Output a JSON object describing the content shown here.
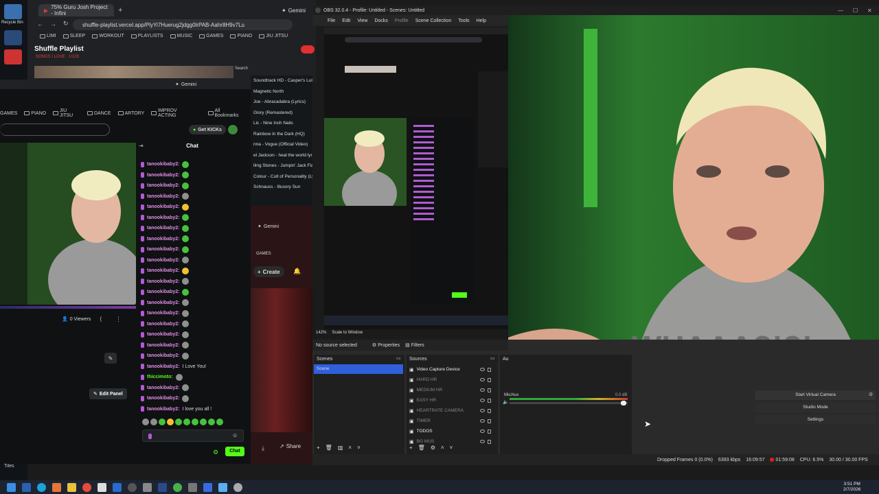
{
  "desktop": {
    "recycle_bin": "Recycle Bin",
    "tiles": "Tiles"
  },
  "browser1": {
    "tab_title": "75% Guru Josh Project - Infini",
    "gemini": "Gemini",
    "url": "shuffle-playlist.vercel.app/PlyYi7Huerug2jdgg0lrPAB-Aahr8H9v7Lu",
    "bookmarks": [
      "LIMI",
      "SLEEP",
      "WORKOUT",
      "PLAYLISTS",
      "MUSIC",
      "GAMES",
      "PIANO",
      "JIU JITSU"
    ],
    "site_title": "Shuffle Playlist",
    "site_subtitle": "SONGS I LOVE · 1/225",
    "search_label": "Search"
  },
  "kick": {
    "gemini": "Gemini",
    "bookmarks": [
      "GAMES",
      "PIANO",
      "JIU JITSU",
      "DANCE",
      "ARTORY",
      "IMPROV ACTING"
    ],
    "all_bookmarks": "All Bookmarks",
    "get_kicks": "Get KICKs",
    "chat_title": "Chat",
    "viewers": "0 Viewers",
    "edit_panel": "Edit Panel",
    "chat_button": "Chat",
    "messages": [
      {
        "user": "tanookibaby2:",
        "text": "",
        "emote": "green"
      },
      {
        "user": "tanookibaby2:",
        "text": "",
        "emote": "green"
      },
      {
        "user": "tanookibaby2:",
        "text": "",
        "emote": "green"
      },
      {
        "user": "tanookibaby2:",
        "text": "",
        "emote": "gray"
      },
      {
        "user": "tanookibaby2:",
        "text": "",
        "emote": "yellow"
      },
      {
        "user": "tanookibaby2:",
        "text": "",
        "emote": "green"
      },
      {
        "user": "tanookibaby2:",
        "text": "",
        "emote": "green"
      },
      {
        "user": "tanookibaby2:",
        "text": "",
        "emote": "green"
      },
      {
        "user": "tanookibaby2:",
        "text": "",
        "emote": "green"
      },
      {
        "user": "tanookibaby2:",
        "text": "",
        "emote": "gray"
      },
      {
        "user": "tanookibaby2:",
        "text": "",
        "emote": "yellow"
      },
      {
        "user": "tanookibaby2:",
        "text": "",
        "emote": "gray"
      },
      {
        "user": "tanookibaby2:",
        "text": "",
        "emote": "green"
      },
      {
        "user": "tanookibaby2:",
        "text": "",
        "emote": "gray"
      },
      {
        "user": "tanookibaby2:",
        "text": "",
        "emote": "gray"
      },
      {
        "user": "tanookibaby2:",
        "text": "",
        "emote": "gray"
      },
      {
        "user": "tanookibaby2:",
        "text": "",
        "emote": "gray"
      },
      {
        "user": "tanookibaby2:",
        "text": "",
        "emote": "gray"
      },
      {
        "user": "tanookibaby2:",
        "text": "",
        "emote": "gray"
      },
      {
        "user": "tanookibaby2:",
        "text": "I Love You!",
        "emote": ""
      },
      {
        "user": "thiccimoto:",
        "text": "",
        "emote": "gray"
      },
      {
        "user": "tanookibaby2:",
        "text": "",
        "emote": "gray"
      },
      {
        "user": "tanookibaby2:",
        "text": "",
        "emote": "gray"
      },
      {
        "user": "tanookibaby2:",
        "text": "I love you all !",
        "emote": ""
      }
    ]
  },
  "playlist": {
    "items": [
      "Soundtrack HD - Casper's Lullaby",
      "Magnetic North",
      "Joe - Abracadabra (Lyrics)",
      "Glory (Remastered)",
      "Lic - Nine Inch Nails",
      "Rainbow In the Dark (HQ)",
      "nna - Vogue (Official Video)",
      "el Jackson - heal the world lyrics",
      "lling Stones - Jumpin' Jack Flash",
      "Colour - Cult of Personality (Lyrics)",
      "Schnauss - Illusory Sun"
    ],
    "gemini": "Gemini",
    "games": "GAMES",
    "create": "Create",
    "share": "Share"
  },
  "obs": {
    "title": "OBS 32.0.4 - Profile: Untitled - Scenes: Untitled",
    "menu": [
      "File",
      "Edit",
      "View",
      "Docks",
      "Profile",
      "Scene Collection",
      "Tools",
      "Help"
    ],
    "no_source": "No source selected",
    "properties": "Properties",
    "filters": "Filters",
    "scenes_title": "Scenes",
    "scenes": [
      "Scene"
    ],
    "sources_title": "Sources",
    "sources": [
      "Video Capture Device",
      "HARD HR",
      "MEDIUM HR",
      "EASY HR",
      "HEARTRATE CAMERA",
      "TIMER",
      "TODOS",
      "BG MUS"
    ],
    "audio_title": "Au",
    "mic_label": "Mic/Aux",
    "mic_db": "0.0 dB",
    "controls": [
      "Start Virtual Camera",
      "Studio Mode",
      "Settings"
    ],
    "scale_label": "Scale to Window",
    "zoom": "142%",
    "status": {
      "dropped": "Dropped Frames 0 (0.0%)",
      "bitrate": "6393 kbps",
      "time1": "16:09:57",
      "time2": "01:59:08",
      "cpu": "CPU: 6.5%",
      "fps": "30.00 / 30.00 FPS"
    }
  },
  "taskbar": {
    "time": "3:51 PM",
    "date": "2/7/2026"
  },
  "colors": {
    "kick_green": "#53fc18",
    "obs_selected": "#2f5fdb",
    "chat_user": "#e28ee6",
    "live_red": "#e02020"
  }
}
